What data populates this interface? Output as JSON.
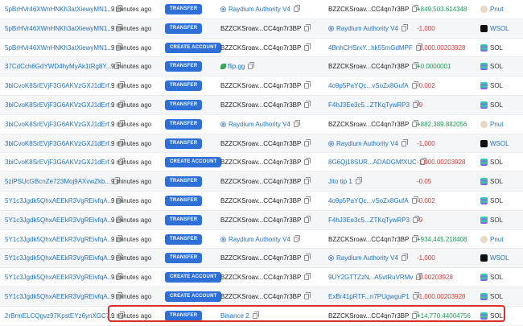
{
  "colors": {
    "link": "#1a73c9",
    "badge": "#2e6fd8",
    "positive": "#1a9c55",
    "negative": "#d83a3a",
    "highlight": "#d93025"
  },
  "rows": [
    {
      "signature": "5pBrHVr46XWnHNKh3atXiewyMN1...",
      "time": "9 minutes ago",
      "action": "TRANSFER",
      "from": "Raydium Authority V4",
      "from_style": "account",
      "to": "BZZCKSroav...CC4qn7r3BP",
      "to_style": "plain",
      "amount": "+849,503.614348",
      "sign": "pos",
      "token": "Pnut",
      "token_icon": "pnut"
    },
    {
      "signature": "5pBrHVr46XWnHNKh3atXiewyMN1...",
      "time": "9 minutes ago",
      "action": "TRANSFER",
      "from": "BZZCKSroav...CC4qn7r3BP",
      "from_style": "plain",
      "to": "Raydium Authority V4",
      "to_style": "account",
      "amount": "-1,000",
      "sign": "neg",
      "token": "WSOL",
      "token_icon": "wsol"
    },
    {
      "signature": "5pBrHVr46XWnHNKh3atXiewyMN1...",
      "time": "9 minutes ago",
      "action": "CREATE ACCOUNT",
      "from": "BZZCKSroav...CC4qn7r3BP",
      "from_style": "plain",
      "to": "4BnhCHSrxY...hk55mGdMPF",
      "to_style": "link",
      "amount": "-1,000.00203928",
      "sign": "neg",
      "token": "SOL",
      "token_icon": "sol"
    },
    {
      "signature": "37CdCch6GdYWD4hyMyAk1tRg8Y...",
      "time": "9 minutes ago",
      "action": "TRANSFER",
      "from": "flip.gg",
      "from_style": "leaf",
      "to": "BZZCKSroav...CC4qn7r3BP",
      "to_style": "plain",
      "amount": "+0.0000001",
      "sign": "pos",
      "token": "SOL",
      "token_icon": "sol"
    },
    {
      "signature": "3biCvoK8SrEVjF3G6AKVzGXJ1dErf...",
      "time": "9 minutes ago",
      "action": "TRANSFER",
      "from": "BZZCKSroav...CC4qn7r3BP",
      "from_style": "plain",
      "to": "4o9p5PaYQc...vSoZx8GufA",
      "to_style": "link",
      "amount": "-0.002",
      "sign": "neg",
      "token": "SOL",
      "token_icon": "sol"
    },
    {
      "signature": "3biCvoK8SrEVjF3G6AKVzGXJ1dErf...",
      "time": "9 minutes ago",
      "action": "TRANSFER",
      "from": "BZZCKSroav...CC4qn7r3BP",
      "from_style": "plain",
      "to": "F4hJ3Ee3c5...ZTKqTywRP3",
      "to_style": "link",
      "amount": "-9",
      "sign": "neg",
      "token": "SOL",
      "token_icon": "sol"
    },
    {
      "signature": "3biCvoK8SrEVjF3G6AKVzGXJ1dErf...",
      "time": "9 minutes ago",
      "action": "TRANSFER",
      "from": "Raydium Authority V4",
      "from_style": "account",
      "to": "BZZCKSroav...CC4qn7r3BP",
      "to_style": "plain",
      "amount": "+882,389.882056",
      "sign": "pos",
      "token": "Pnut",
      "token_icon": "pnut"
    },
    {
      "signature": "3biCvoK8SrEVjF3G6AKVzGXJ1dErf...",
      "time": "9 minutes ago",
      "action": "TRANSFER",
      "from": "BZZCKSroav...CC4qn7r3BP",
      "from_style": "plain",
      "to": "Raydium Authority V4",
      "to_style": "account",
      "amount": "-1,000",
      "sign": "neg",
      "token": "WSOL",
      "token_icon": "wsol"
    },
    {
      "signature": "3biCvoK8SrEVjF3G6AKVzGXJ1dErf...",
      "time": "9 minutes ago",
      "action": "CREATE ACCOUNT",
      "from": "BZZCKSroav...CC4qn7r3BP",
      "from_style": "plain",
      "to": "8G6Qj18SUR...ADADGMfXUC",
      "to_style": "link",
      "amount": "-1,000.00203928",
      "sign": "neg",
      "token": "SOL",
      "token_icon": "sol"
    },
    {
      "signature": "5ziPSUcGBcnZe723Moj9AXvwZkb...",
      "time": "9 minutes ago",
      "action": "TRANSFER",
      "from": "BZZCKSroav...CC4qn7r3BP",
      "from_style": "plain",
      "to": "Jito tip 1",
      "to_style": "link",
      "amount": "-0.05",
      "sign": "neg",
      "token": "SOL",
      "token_icon": "sol"
    },
    {
      "signature": "5Y1c3Jgdk5QhxAEEkR3VgREivfqA...",
      "time": "9 minutes ago",
      "action": "TRANSFER",
      "from": "BZZCKSroav...CC4qn7r3BP",
      "from_style": "plain",
      "to": "4o9p5PaYQc...vSoZx8GufA",
      "to_style": "link",
      "amount": "-0.002",
      "sign": "neg",
      "token": "SOL",
      "token_icon": "sol"
    },
    {
      "signature": "5Y1c3Jgdk5QhxAEEkR3VgREivfqA...",
      "time": "9 minutes ago",
      "action": "TRANSFER",
      "from": "BZZCKSroav...CC4qn7r3BP",
      "from_style": "plain",
      "to": "F4hJ3Ee3c5...ZTKqTywRP3",
      "to_style": "link",
      "amount": "-9",
      "sign": "neg",
      "token": "SOL",
      "token_icon": "sol"
    },
    {
      "signature": "5Y1c3Jgdk5QhxAEEkR3VgREivfqA...",
      "time": "9 minutes ago",
      "action": "TRANSFER",
      "from": "Raydium Authority V4",
      "from_style": "account",
      "to": "BZZCKSroav...CC4qn7r3BP",
      "to_style": "plain",
      "amount": "+934,445.218408",
      "sign": "pos",
      "token": "Pnut",
      "token_icon": "pnut"
    },
    {
      "signature": "5Y1c3Jgdk5QhxAEEkR3VgREivfqA...",
      "time": "9 minutes ago",
      "action": "TRANSFER",
      "from": "BZZCKSroav...CC4qn7r3BP",
      "from_style": "plain",
      "to": "Raydium Authority V4",
      "to_style": "account",
      "amount": "-1,000",
      "sign": "neg",
      "token": "WSOL",
      "token_icon": "wsol"
    },
    {
      "signature": "5Y1c3Jgdk5QhxAEEkR3VgREivfqA...",
      "time": "9 minutes ago",
      "action": "CREATE ACCOUNT",
      "from": "BZZCKSroav...CC4qn7r3BP",
      "from_style": "plain",
      "to": "9UY2GTTZzN...A5vtRuVRMv",
      "to_style": "link",
      "amount": "-0.00203928",
      "sign": "neg",
      "token": "SOL",
      "token_icon": "sol"
    },
    {
      "signature": "5Y1c3Jgdk5QhxAEEkR3VgREivfqA...",
      "time": "9 minutes ago",
      "action": "CREATE ACCOUNT",
      "from": "BZZCKSroav...CC4qn7r3BP",
      "from_style": "plain",
      "to": "ExBr41pRTF...n7PUgwguP1",
      "to_style": "link",
      "amount": "-1,000.00203928",
      "sign": "neg",
      "token": "SOL",
      "token_icon": "sol"
    },
    {
      "signature": "2rBrmELCQgvz97KpstEYz6ynXGC7...",
      "time": "9 minutes ago",
      "action": "TRANSFER",
      "from": "Binance 2",
      "from_style": "link",
      "to": "BZZCKSroav...CC4qn7r3BP",
      "to_style": "plain",
      "amount": "+14,770.44004756",
      "sign": "pos",
      "token": "SOL",
      "token_icon": "sol"
    }
  ]
}
